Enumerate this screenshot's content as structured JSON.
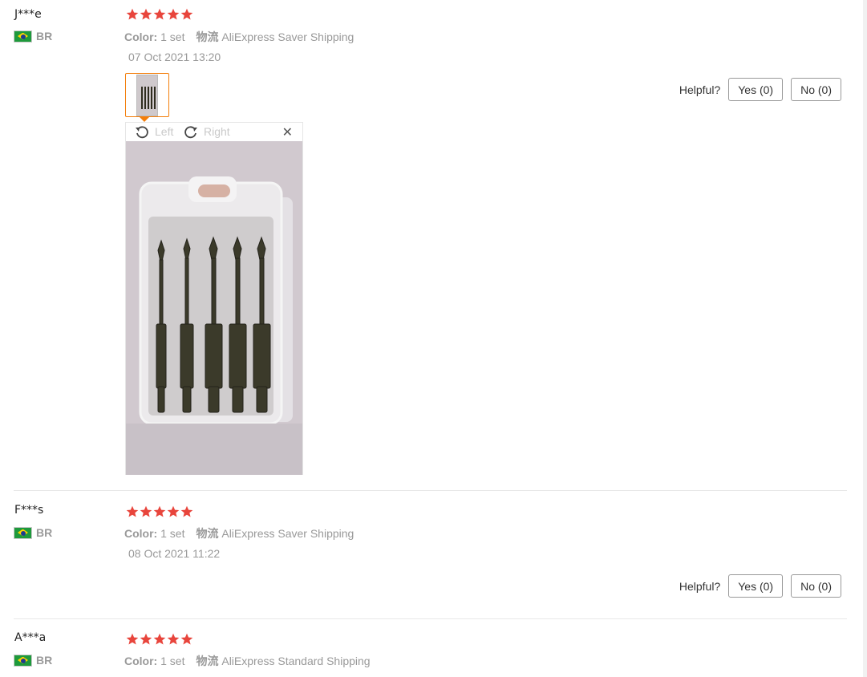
{
  "reviews": [
    {
      "user": "J***e",
      "country": "BR",
      "rating": 5,
      "color_label": "Color:",
      "color_value": "1 set",
      "shipping_label": "物流",
      "shipping_value": "AliExpress Saver Shipping",
      "date": "07 Oct 2021 13:20",
      "has_photo": true,
      "helpful_label": "Helpful?",
      "yes_label": "Yes (0)",
      "no_label": "No (0)"
    },
    {
      "user": "F***s",
      "country": "BR",
      "rating": 5,
      "color_label": "Color:",
      "color_value": "1 set",
      "shipping_label": "物流",
      "shipping_value": "AliExpress Saver Shipping",
      "date": "08 Oct 2021 11:22",
      "helpful_label": "Helpful?",
      "yes_label": "Yes (0)",
      "no_label": "No (0)"
    },
    {
      "user": "A***a",
      "country": "BR",
      "rating": 5,
      "color_label": "Color:",
      "color_value": "1 set",
      "shipping_label": "物流",
      "shipping_value": "AliExpress Standard Shipping"
    }
  ],
  "viewer": {
    "rotate_left_label": "Left",
    "rotate_right_label": "Right",
    "close_icon": "close-icon"
  },
  "colors": {
    "star": "#e8453c",
    "accent": "#f37e0b",
    "muted": "#999999"
  }
}
